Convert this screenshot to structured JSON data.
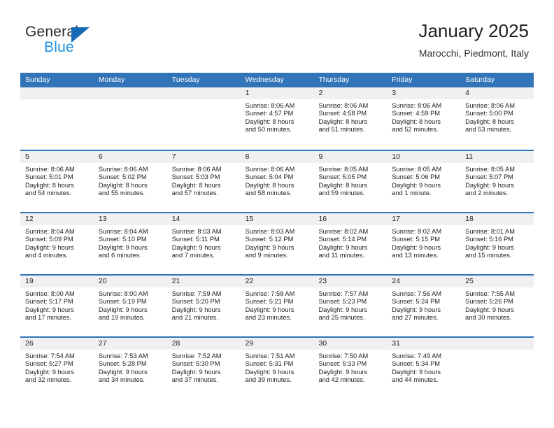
{
  "brand": {
    "name_top": "General",
    "name_bottom": "Blue",
    "triangle_color": "#1669b5",
    "blue_text_color": "#1f8fe0"
  },
  "header": {
    "title": "January 2025",
    "subtitle": "Marocchi, Piedmont, Italy"
  },
  "theme": {
    "header_blue": "#3274b8",
    "day_band_gray": "#f0f0f0",
    "text_color": "#222222"
  },
  "weekday_headers": [
    "Sunday",
    "Monday",
    "Tuesday",
    "Wednesday",
    "Thursday",
    "Friday",
    "Saturday"
  ],
  "weeks": [
    [
      {
        "day": "",
        "empty": true
      },
      {
        "day": "",
        "empty": true
      },
      {
        "day": "",
        "empty": true
      },
      {
        "day": "1",
        "sunrise": "Sunrise: 8:06 AM",
        "sunset": "Sunset: 4:57 PM",
        "daylight1": "Daylight: 8 hours",
        "daylight2": "and 50 minutes."
      },
      {
        "day": "2",
        "sunrise": "Sunrise: 8:06 AM",
        "sunset": "Sunset: 4:58 PM",
        "daylight1": "Daylight: 8 hours",
        "daylight2": "and 51 minutes."
      },
      {
        "day": "3",
        "sunrise": "Sunrise: 8:06 AM",
        "sunset": "Sunset: 4:59 PM",
        "daylight1": "Daylight: 8 hours",
        "daylight2": "and 52 minutes."
      },
      {
        "day": "4",
        "sunrise": "Sunrise: 8:06 AM",
        "sunset": "Sunset: 5:00 PM",
        "daylight1": "Daylight: 8 hours",
        "daylight2": "and 53 minutes."
      }
    ],
    [
      {
        "day": "5",
        "sunrise": "Sunrise: 8:06 AM",
        "sunset": "Sunset: 5:01 PM",
        "daylight1": "Daylight: 8 hours",
        "daylight2": "and 54 minutes."
      },
      {
        "day": "6",
        "sunrise": "Sunrise: 8:06 AM",
        "sunset": "Sunset: 5:02 PM",
        "daylight1": "Daylight: 8 hours",
        "daylight2": "and 55 minutes."
      },
      {
        "day": "7",
        "sunrise": "Sunrise: 8:06 AM",
        "sunset": "Sunset: 5:03 PM",
        "daylight1": "Daylight: 8 hours",
        "daylight2": "and 57 minutes."
      },
      {
        "day": "8",
        "sunrise": "Sunrise: 8:06 AM",
        "sunset": "Sunset: 5:04 PM",
        "daylight1": "Daylight: 8 hours",
        "daylight2": "and 58 minutes."
      },
      {
        "day": "9",
        "sunrise": "Sunrise: 8:05 AM",
        "sunset": "Sunset: 5:05 PM",
        "daylight1": "Daylight: 8 hours",
        "daylight2": "and 59 minutes."
      },
      {
        "day": "10",
        "sunrise": "Sunrise: 8:05 AM",
        "sunset": "Sunset: 5:06 PM",
        "daylight1": "Daylight: 9 hours",
        "daylight2": "and 1 minute."
      },
      {
        "day": "11",
        "sunrise": "Sunrise: 8:05 AM",
        "sunset": "Sunset: 5:07 PM",
        "daylight1": "Daylight: 9 hours",
        "daylight2": "and 2 minutes."
      }
    ],
    [
      {
        "day": "12",
        "sunrise": "Sunrise: 8:04 AM",
        "sunset": "Sunset: 5:09 PM",
        "daylight1": "Daylight: 9 hours",
        "daylight2": "and 4 minutes."
      },
      {
        "day": "13",
        "sunrise": "Sunrise: 8:04 AM",
        "sunset": "Sunset: 5:10 PM",
        "daylight1": "Daylight: 9 hours",
        "daylight2": "and 6 minutes."
      },
      {
        "day": "14",
        "sunrise": "Sunrise: 8:03 AM",
        "sunset": "Sunset: 5:11 PM",
        "daylight1": "Daylight: 9 hours",
        "daylight2": "and 7 minutes."
      },
      {
        "day": "15",
        "sunrise": "Sunrise: 8:03 AM",
        "sunset": "Sunset: 5:12 PM",
        "daylight1": "Daylight: 9 hours",
        "daylight2": "and 9 minutes."
      },
      {
        "day": "16",
        "sunrise": "Sunrise: 8:02 AM",
        "sunset": "Sunset: 5:14 PM",
        "daylight1": "Daylight: 9 hours",
        "daylight2": "and 11 minutes."
      },
      {
        "day": "17",
        "sunrise": "Sunrise: 8:02 AM",
        "sunset": "Sunset: 5:15 PM",
        "daylight1": "Daylight: 9 hours",
        "daylight2": "and 13 minutes."
      },
      {
        "day": "18",
        "sunrise": "Sunrise: 8:01 AM",
        "sunset": "Sunset: 5:16 PM",
        "daylight1": "Daylight: 9 hours",
        "daylight2": "and 15 minutes."
      }
    ],
    [
      {
        "day": "19",
        "sunrise": "Sunrise: 8:00 AM",
        "sunset": "Sunset: 5:17 PM",
        "daylight1": "Daylight: 9 hours",
        "daylight2": "and 17 minutes."
      },
      {
        "day": "20",
        "sunrise": "Sunrise: 8:00 AM",
        "sunset": "Sunset: 5:19 PM",
        "daylight1": "Daylight: 9 hours",
        "daylight2": "and 19 minutes."
      },
      {
        "day": "21",
        "sunrise": "Sunrise: 7:59 AM",
        "sunset": "Sunset: 5:20 PM",
        "daylight1": "Daylight: 9 hours",
        "daylight2": "and 21 minutes."
      },
      {
        "day": "22",
        "sunrise": "Sunrise: 7:58 AM",
        "sunset": "Sunset: 5:21 PM",
        "daylight1": "Daylight: 9 hours",
        "daylight2": "and 23 minutes."
      },
      {
        "day": "23",
        "sunrise": "Sunrise: 7:57 AM",
        "sunset": "Sunset: 5:23 PM",
        "daylight1": "Daylight: 9 hours",
        "daylight2": "and 25 minutes."
      },
      {
        "day": "24",
        "sunrise": "Sunrise: 7:56 AM",
        "sunset": "Sunset: 5:24 PM",
        "daylight1": "Daylight: 9 hours",
        "daylight2": "and 27 minutes."
      },
      {
        "day": "25",
        "sunrise": "Sunrise: 7:55 AM",
        "sunset": "Sunset: 5:26 PM",
        "daylight1": "Daylight: 9 hours",
        "daylight2": "and 30 minutes."
      }
    ],
    [
      {
        "day": "26",
        "sunrise": "Sunrise: 7:54 AM",
        "sunset": "Sunset: 5:27 PM",
        "daylight1": "Daylight: 9 hours",
        "daylight2": "and 32 minutes."
      },
      {
        "day": "27",
        "sunrise": "Sunrise: 7:53 AM",
        "sunset": "Sunset: 5:28 PM",
        "daylight1": "Daylight: 9 hours",
        "daylight2": "and 34 minutes."
      },
      {
        "day": "28",
        "sunrise": "Sunrise: 7:52 AM",
        "sunset": "Sunset: 5:30 PM",
        "daylight1": "Daylight: 9 hours",
        "daylight2": "and 37 minutes."
      },
      {
        "day": "29",
        "sunrise": "Sunrise: 7:51 AM",
        "sunset": "Sunset: 5:31 PM",
        "daylight1": "Daylight: 9 hours",
        "daylight2": "and 39 minutes."
      },
      {
        "day": "30",
        "sunrise": "Sunrise: 7:50 AM",
        "sunset": "Sunset: 5:33 PM",
        "daylight1": "Daylight: 9 hours",
        "daylight2": "and 42 minutes."
      },
      {
        "day": "31",
        "sunrise": "Sunrise: 7:49 AM",
        "sunset": "Sunset: 5:34 PM",
        "daylight1": "Daylight: 9 hours",
        "daylight2": "and 44 minutes."
      },
      {
        "day": "",
        "empty": true
      }
    ]
  ]
}
